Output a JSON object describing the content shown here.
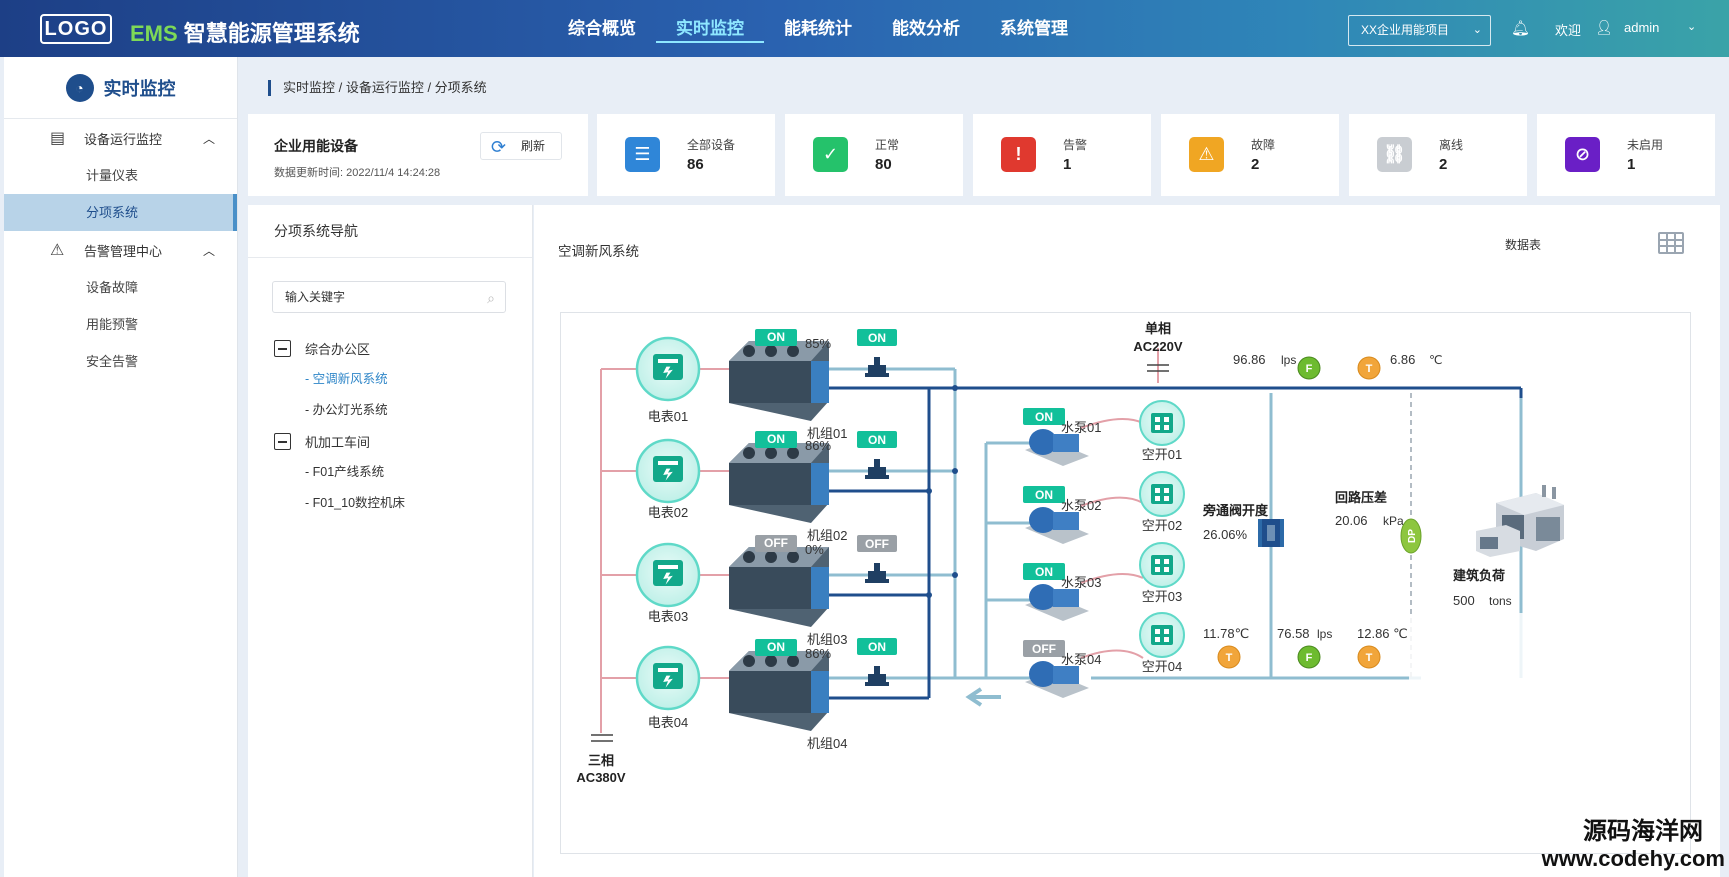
{
  "header": {
    "logo": "LOGO",
    "title_prefix": "EMS",
    "title": "智慧能源管理系统",
    "nav": [
      "综合概览",
      "实时监控",
      "能耗统计",
      "能效分析",
      "系统管理"
    ],
    "project": "XX企业用能项目",
    "welcome": "欢迎",
    "user": "admin"
  },
  "sidebar": {
    "title": "实时监控",
    "group1": "设备运行监控",
    "group1_items": [
      "计量仪表",
      "分项系统"
    ],
    "group2": "告警管理中心",
    "group2_items": [
      "设备故障",
      "用能预警",
      "安全告警"
    ]
  },
  "breadcrumb": "实时监控 / 设备运行监控 / 分项系统",
  "summary": {
    "title": "企业用能设备",
    "update_time": "数据更新时间:   2022/11/4 14:24:28",
    "refresh": "刷新"
  },
  "stats": [
    {
      "label": "全部设备",
      "value": "86",
      "color": "#2f86d8",
      "icon": "server-icon"
    },
    {
      "label": "正常",
      "value": "80",
      "color": "#25c26b",
      "icon": "check-icon"
    },
    {
      "label": "告警",
      "value": "1",
      "color": "#e0392f",
      "icon": "shield-alert-icon"
    },
    {
      "label": "故障",
      "value": "2",
      "color": "#f0a623",
      "icon": "warning-icon"
    },
    {
      "label": "离线",
      "value": "2",
      "color": "#c9cdd2",
      "icon": "offline-link-icon"
    },
    {
      "label": "未启用",
      "value": "1",
      "color": "#6a1fc6",
      "icon": "disabled-icon"
    }
  ],
  "nav_panel": {
    "title": "分项系统导航",
    "search_placeholder": "输入关键字",
    "groups": [
      {
        "label": "综合办公区",
        "items": [
          "空调新风系统",
          "办公灯光系统"
        ]
      },
      {
        "label": "机加工车间",
        "items": [
          "F01产线系统",
          "F01_10数控机床"
        ]
      }
    ]
  },
  "main": {
    "title": "空调新风系统",
    "table_label": "数据表",
    "supply_single": [
      "单相",
      "AC220V"
    ],
    "supply_three": [
      "三相",
      "AC380V"
    ],
    "meters": [
      "电表01",
      "电表02",
      "电表03",
      "电表04"
    ],
    "units": [
      {
        "name": "机组01",
        "status": "ON",
        "valve": "ON",
        "load": "85%"
      },
      {
        "name": "机组02",
        "status": "ON",
        "valve": "ON",
        "load": "86%"
      },
      {
        "name": "机组03",
        "status": "OFF",
        "valve": "OFF",
        "load": "0%"
      },
      {
        "name": "机组04",
        "status": "ON",
        "valve": "ON",
        "load": "86%"
      }
    ],
    "pumps": [
      {
        "name": "水泵01",
        "status": "ON"
      },
      {
        "name": "水泵02",
        "status": "ON"
      },
      {
        "name": "水泵03",
        "status": "ON"
      },
      {
        "name": "水泵04",
        "status": "OFF"
      }
    ],
    "breakers": [
      "空开01",
      "空开02",
      "空开03",
      "空开04"
    ],
    "sensors": {
      "flow_top": "96.86",
      "flow_unit": "lps",
      "temp_top": "6.86",
      "temp_unit": "℃",
      "bypass_label": "旁通阀开度",
      "bypass_value": "26.06%",
      "dp_label": "回路压差",
      "dp_value": "20.06",
      "dp_unit": "kPa",
      "load_label": "建筑负荷",
      "load_value": "500",
      "load_unit": "tons",
      "temp_bottom1": "11.78℃",
      "flow_bottom": "76.58",
      "flow_bottom_unit": "lps",
      "temp_bottom2": "12.86 ℃"
    },
    "sensor_letters": {
      "flow": "F",
      "temp": "T",
      "dp": "DP"
    }
  },
  "watermark": [
    "源码海洋网",
    "www.codehy.com"
  ],
  "colors": {
    "on": "#12c09a",
    "off": "#9aa0a6",
    "pipe_dark": "#1f4e8c",
    "pipe_light": "#8fbdd0",
    "line_red": "#e3a0a8"
  }
}
